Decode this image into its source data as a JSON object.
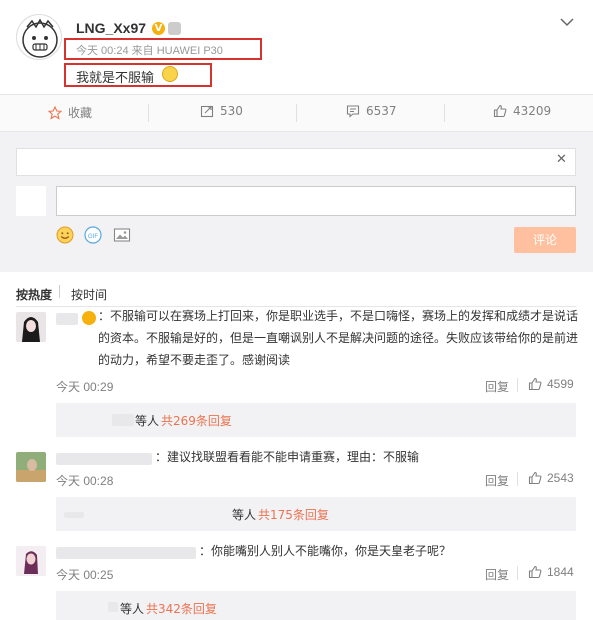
{
  "post": {
    "username": "LNG_Xx97",
    "verified_badge": "V",
    "meta": "今天 00:24 来自 HUAWEI P30",
    "content": "我就是不服输",
    "highlight_color": "#d6322f"
  },
  "actions": {
    "favorite_label": "收藏",
    "repost_count": "530",
    "comment_count": "6537",
    "like_count": "43209"
  },
  "composer": {
    "submit_label": "评论",
    "tools": [
      "smile-icon",
      "gif-icon",
      "image-icon"
    ]
  },
  "sort": {
    "hot_label": "按热度",
    "time_label": "按时间"
  },
  "comments": [
    {
      "text": "：不服输可以在赛场上打回来，你是职业选手，不是口嗨怪，赛场上的发挥和成绩才是说话的资本。不服输是好的，但是一直嘲讽别人不是解决问题的途径。失败应该带给你的是前进的动力，希望不要走歪了。感谢阅读",
      "time": "今天 00:29",
      "reply_label": "回复",
      "likes": "4599",
      "sub_prefix": "等人",
      "sub_link": "共269条回复"
    },
    {
      "text": "：建议找联盟看看能不能申请重赛，理由：不服输",
      "time": "今天 00:28",
      "reply_label": "回复",
      "likes": "2543",
      "sub_prefix": "等人",
      "sub_link": "共175条回复"
    },
    {
      "text": "：你能嘴别人别人不能嘴你，你是天皇老子呢？",
      "time": "今天 00:25",
      "reply_label": "回复",
      "likes": "1844",
      "sub_prefix": "等人",
      "sub_link": "共342条回复"
    }
  ]
}
